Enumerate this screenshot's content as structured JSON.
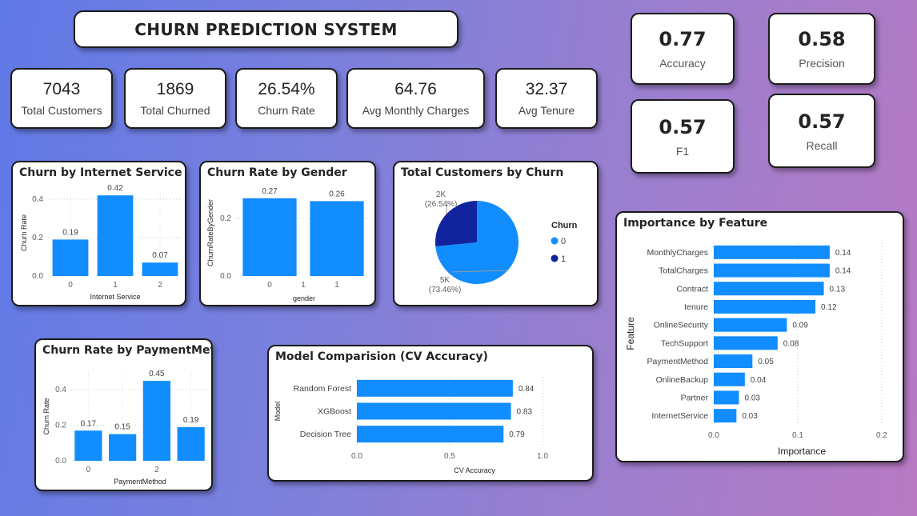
{
  "header": {
    "title": "CHURN PREDICTION SYSTEM"
  },
  "kpis": [
    {
      "value": "7043",
      "label": "Total Customers"
    },
    {
      "value": "1869",
      "label": "Total Churned"
    },
    {
      "value": "26.54%",
      "label": "Churn Rate"
    },
    {
      "value": "64.76",
      "label": "Avg Monthly Charges"
    },
    {
      "value": "32.37",
      "label": "Avg Tenure"
    }
  ],
  "metrics": [
    {
      "value": "0.77",
      "label": "Accuracy"
    },
    {
      "value": "0.58",
      "label": "Precision"
    },
    {
      "value": "0.57",
      "label": "F1"
    },
    {
      "value": "0.57",
      "label": "Recall"
    }
  ],
  "colors": {
    "primary": "#118dff",
    "dark": "#12239e"
  },
  "chart_data": [
    {
      "id": "internet",
      "type": "bar",
      "title": "Churn by Internet Service",
      "xlabel": "Internet Service",
      "ylabel": "Churn Rate",
      "categories": [
        "0",
        "1",
        "2"
      ],
      "values": [
        0.19,
        0.42,
        0.07
      ],
      "labels": [
        "0.19",
        "0.42",
        "0.07"
      ],
      "ylim": [
        0,
        0.45
      ],
      "yticks": [
        0.0,
        0.2,
        0.4
      ],
      "ytick_labels": [
        "0.0",
        "0.2",
        "0.4"
      ],
      "grid": true
    },
    {
      "id": "gender",
      "type": "bar",
      "title": "Churn Rate by Gender",
      "xlabel": "gender",
      "ylabel": "ChurnRateByGender",
      "x": [
        0,
        1
      ],
      "values": [
        0.27,
        0.26
      ],
      "labels": [
        "0.27",
        "0.26"
      ],
      "xticks": [
        0,
        1
      ],
      "xtick_labels": [
        "0.0",
        "1",
        "1"
      ],
      "xlim": [
        -0.5,
        1.5
      ],
      "ylim": [
        0,
        0.3
      ],
      "yticks": [
        0.0,
        0.2
      ],
      "ytick_labels": [
        "0.0",
        "0.2"
      ],
      "grid": true
    },
    {
      "id": "pie",
      "type": "pie",
      "title": "Total Customers by Churn",
      "legend_title": "Churn",
      "legend_position": "right",
      "slices": [
        {
          "name": "0",
          "value": 5174,
          "label": "5K",
          "pct": "(73.46%)",
          "color": "#118dff"
        },
        {
          "name": "1",
          "value": 1869,
          "label": "2K",
          "pct": "(26.54%)",
          "color": "#12239e"
        }
      ]
    },
    {
      "id": "payment",
      "type": "bar",
      "title": "Churn Rate by PaymentMethod",
      "xlabel": "PaymentMethod",
      "ylabel": "Churn Rate",
      "categories": [
        "0",
        "1",
        "2",
        "3"
      ],
      "shown_tick_labels": [
        "0",
        "",
        "2",
        ""
      ],
      "values": [
        0.17,
        0.15,
        0.45,
        0.19
      ],
      "labels": [
        "0.17",
        "0.15",
        "0.45",
        "0.19"
      ],
      "ylim": [
        0,
        0.5
      ],
      "yticks": [
        0.0,
        0.2,
        0.4
      ],
      "ytick_labels": [
        "0.0",
        "0.2",
        "0.4"
      ],
      "grid": true
    },
    {
      "id": "model",
      "type": "bar",
      "orientation": "horizontal",
      "title": "Model Comparision (CV Accuracy)",
      "xlabel": "CV Accuracy",
      "ylabel": "Model",
      "categories": [
        "Random Forest",
        "XGBoost",
        "Decision Tree"
      ],
      "values": [
        0.84,
        0.83,
        0.79
      ],
      "labels": [
        "0.84",
        "0.83",
        "0.79"
      ],
      "xlim": [
        0,
        1.0
      ],
      "xticks": [
        0.0,
        0.5,
        1.0
      ],
      "xtick_labels": [
        "0.0",
        "0.5",
        "1.0"
      ],
      "grid": true
    },
    {
      "id": "feature",
      "type": "bar",
      "orientation": "horizontal",
      "title": "Importance by Feature",
      "xlabel": "Importance",
      "ylabel": "Feature",
      "categories": [
        "MonthlyCharges",
        "TotalCharges",
        "Contract",
        "tenure",
        "OnlineSecurity",
        "TechSupport",
        "PaymentMethod",
        "OnlineBackup",
        "Partner",
        "InternetService"
      ],
      "values": [
        0.138,
        0.138,
        0.131,
        0.121,
        0.087,
        0.076,
        0.046,
        0.037,
        0.03,
        0.027
      ],
      "labels": [
        "0.14",
        "0.14",
        "0.13",
        "0.12",
        "0.09",
        "0.08",
        "0.05",
        "0.04",
        "0.03",
        "0.03"
      ],
      "xlim": [
        0,
        0.2
      ],
      "xticks": [
        0.0,
        0.1,
        0.2
      ],
      "xtick_labels": [
        "0.0",
        "0.1",
        "0.2"
      ],
      "grid": true
    }
  ]
}
